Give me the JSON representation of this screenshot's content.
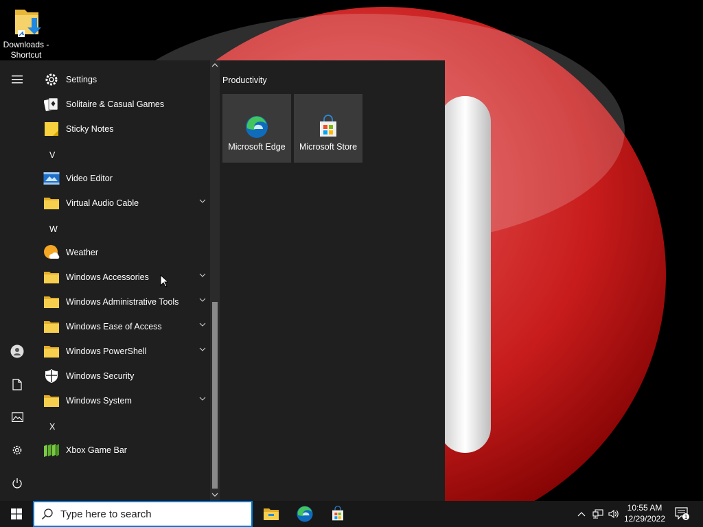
{
  "desktop": {
    "icon_label_line1": "Downloads -",
    "icon_label_line2": "Shortcut"
  },
  "start_menu": {
    "rail": [
      {
        "icon": "hamburger-menu-icon"
      },
      {
        "icon": "user-icon"
      },
      {
        "icon": "documents-icon"
      },
      {
        "icon": "pictures-icon"
      },
      {
        "icon": "settings-gear-icon"
      },
      {
        "icon": "power-icon"
      }
    ],
    "apps": [
      {
        "kind": "app",
        "label": "Settings",
        "icon": "settings-icon",
        "expandable": false
      },
      {
        "kind": "app",
        "label": "Solitaire & Casual Games",
        "icon": "solitaire-icon",
        "expandable": false
      },
      {
        "kind": "app",
        "label": "Sticky Notes",
        "icon": "sticky-notes-icon",
        "expandable": false
      },
      {
        "kind": "letter",
        "label": "V"
      },
      {
        "kind": "app",
        "label": "Video Editor",
        "icon": "video-editor-icon",
        "expandable": false
      },
      {
        "kind": "app",
        "label": "Virtual Audio Cable",
        "icon": "folder-icon",
        "expandable": true
      },
      {
        "kind": "letter",
        "label": "W"
      },
      {
        "kind": "app",
        "label": "Weather",
        "icon": "weather-icon",
        "expandable": false
      },
      {
        "kind": "app",
        "label": "Windows Accessories",
        "icon": "folder-icon",
        "expandable": true
      },
      {
        "kind": "app",
        "label": "Windows Administrative Tools",
        "icon": "folder-icon",
        "expandable": true
      },
      {
        "kind": "app",
        "label": "Windows Ease of Access",
        "icon": "folder-icon",
        "expandable": true
      },
      {
        "kind": "app",
        "label": "Windows PowerShell",
        "icon": "folder-icon",
        "expandable": true
      },
      {
        "kind": "app",
        "label": "Windows Security",
        "icon": "shield-icon",
        "expandable": false
      },
      {
        "kind": "app",
        "label": "Windows System",
        "icon": "folder-icon",
        "expandable": true
      },
      {
        "kind": "letter",
        "label": "X"
      },
      {
        "kind": "app",
        "label": "Xbox Game Bar",
        "icon": "xbox-game-bar-icon",
        "expandable": false
      }
    ],
    "tiles_group": {
      "title": "Productivity",
      "tiles": [
        {
          "label": "Microsoft Edge",
          "icon": "edge-icon"
        },
        {
          "label": "Microsoft Store",
          "icon": "store-icon"
        }
      ]
    }
  },
  "taskbar": {
    "search_placeholder": "Type here to search",
    "pinned": [
      {
        "icon": "file-explorer-icon"
      },
      {
        "icon": "edge-icon"
      },
      {
        "icon": "store-icon"
      }
    ],
    "tray_icons": [
      "chevron-up-icon",
      "network-icon",
      "volume-icon"
    ],
    "time": "10:55 AM",
    "date": "12/29/2022",
    "notification_count": "1"
  },
  "colors": {
    "accent": "#0078d7",
    "start_bg": "#1f1f1f",
    "taskbar_bg": "#181818",
    "tile_bg": "#3a3a3a",
    "folder": "#f4c542"
  }
}
